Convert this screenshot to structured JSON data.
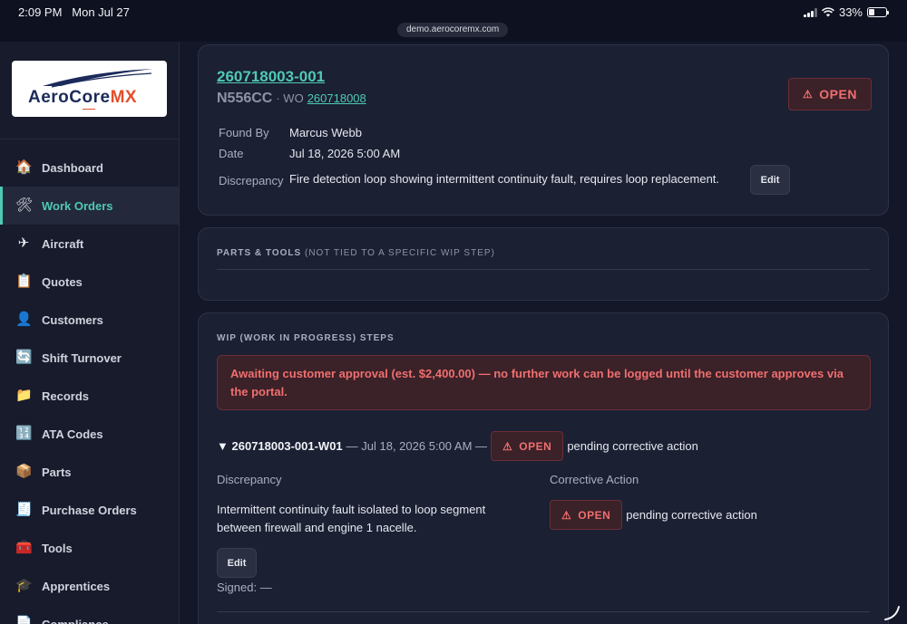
{
  "status_bar": {
    "time": "2:09 PM",
    "date": "Mon Jul 27",
    "url": "demo.aerocoremx.com",
    "battery_percent": "33%",
    "battery_level": 0.33
  },
  "brand": {
    "logo_text_main": "AeroCore",
    "logo_text_accent": "MX",
    "accent_color": "#4fc9b4",
    "danger_color": "#ef6f6f"
  },
  "sidebar": {
    "items": [
      {
        "label": "Dashboard",
        "icon": "house-icon",
        "glyph": "🏠"
      },
      {
        "label": "Work Orders",
        "icon": "tools-icon",
        "glyph": "🛠",
        "active": true
      },
      {
        "label": "Aircraft",
        "icon": "airplane-icon",
        "glyph": "✈"
      },
      {
        "label": "Quotes",
        "icon": "clipboard-icon",
        "glyph": "📋"
      },
      {
        "label": "Customers",
        "icon": "person-icon",
        "glyph": "👤"
      },
      {
        "label": "Shift Turnover",
        "icon": "refresh-icon",
        "glyph": "🔄"
      },
      {
        "label": "Records",
        "icon": "folder-icon",
        "glyph": "📁"
      },
      {
        "label": "ATA Codes",
        "icon": "numbers-icon",
        "glyph": "🔢"
      },
      {
        "label": "Parts",
        "icon": "package-icon",
        "glyph": "📦"
      },
      {
        "label": "Purchase Orders",
        "icon": "receipt-icon",
        "glyph": "🧾"
      },
      {
        "label": "Tools",
        "icon": "toolbox-icon",
        "glyph": "🧰"
      },
      {
        "label": "Apprentices",
        "icon": "graduation-cap-icon",
        "glyph": "🎓"
      },
      {
        "label": "Compliance",
        "icon": "document-icon",
        "glyph": "📄"
      }
    ]
  },
  "discrepancy": {
    "id": "260718003-001",
    "tail": "N556CC",
    "wo_prefix": "· WO",
    "wo_number": "260718008",
    "status": "OPEN",
    "found_by_label": "Found By",
    "found_by": "Marcus Webb",
    "date_label": "Date",
    "date": "Jul 18, 2026 5:00 AM",
    "discrepancy_label": "Discrepancy",
    "discrepancy_text": "Fire detection loop showing intermittent continuity fault, requires loop replacement.",
    "edit_label": "Edit"
  },
  "parts_tools": {
    "heading": "PARTS & TOOLS",
    "subheading": "(NOT TIED TO A SPECIFIC WIP STEP)"
  },
  "wip": {
    "heading": "WIP (WORK IN PROGRESS) STEPS",
    "alert": "Awaiting customer approval (est. $2,400.00) — no further work can be logged until the customer approves via the portal.",
    "step": {
      "toggle": "▼",
      "id": "260718003-001-W01",
      "meta": "— Jul 18, 2026 5:00 AM —",
      "status": "OPEN",
      "status_note": "pending corrective action",
      "discrepancy_label": "Discrepancy",
      "discrepancy_text": "Intermittent continuity fault isolated to loop segment between firewall and engine 1 nacelle.",
      "corrective_label": "Corrective Action",
      "corrective_status": "OPEN",
      "corrective_note": "pending corrective action",
      "edit_label": "Edit",
      "signed": "Signed: —"
    }
  }
}
